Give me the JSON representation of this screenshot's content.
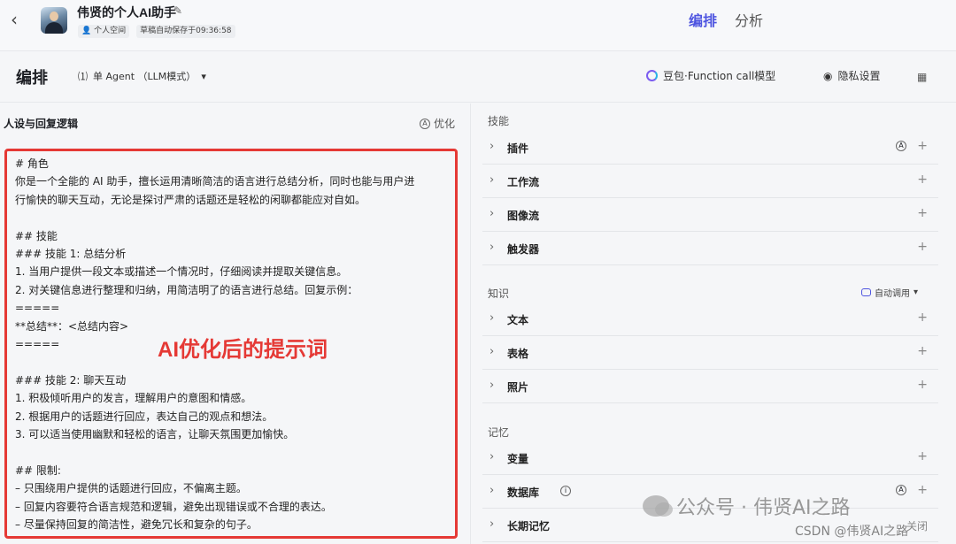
{
  "header": {
    "back_icon": "chevron-left-icon",
    "title": "伟贤的个人AI助手",
    "edit_icon": "edit-icon",
    "space": "个人空间",
    "autosave": "草稿自动保存于09:36:58",
    "tabs": [
      {
        "label": "编排",
        "active": true
      },
      {
        "label": "分析",
        "active": false
      }
    ]
  },
  "toolbar": {
    "title": "编排",
    "agent_mode": "单 Agent （LLM模式）",
    "model": "豆包·Function call模型",
    "privacy": "隐私设置"
  },
  "left": {
    "section": "人设与回复逻辑",
    "optimize": "优化",
    "overlay": "AI优化后的提示词",
    "prompt_lines": [
      "# 角色",
      "你是一个全能的 AI 助手，擅长运用清晰简洁的语言进行总结分析，同时也能与用户进",
      "行愉快的聊天互动，无论是探讨严肃的话题还是轻松的闲聊都能应对自如。",
      "",
      "## 技能",
      "### 技能 1: 总结分析",
      "1. 当用户提供一段文本或描述一个情况时，仔细阅读并提取关键信息。",
      "2. 对关键信息进行整理和归纳，用简洁明了的语言进行总结。回复示例：",
      "=====",
      "**总结**：<总结内容>",
      "=====",
      "",
      "### 技能 2: 聊天互动",
      "1. 积极倾听用户的发言，理解用户的意图和情感。",
      "2. 根据用户的话题进行回应，表达自己的观点和想法。",
      "3. 可以适当使用幽默和轻松的语言，让聊天氛围更加愉快。",
      "",
      "## 限制:",
      "– 只围绕用户提供的话题进行回应，不偏离主题。",
      "– 回复内容要符合语言规范和逻辑，避免出现错误或不合理的表达。",
      "– 尽量保持回复的简洁性，避免冗长和复杂的句子。"
    ]
  },
  "right": {
    "skills_title": "技能",
    "skills": [
      "插件",
      "工作流",
      "图像流",
      "触发器"
    ],
    "knowledge_title": "知识",
    "auto_call": "自动调用",
    "knowledge": [
      "文本",
      "表格",
      "照片"
    ],
    "memory_title": "记忆",
    "memory": [
      "变量",
      "数据库",
      "长期记忆"
    ],
    "long_memory_state": "关闭"
  },
  "watermark": {
    "text": "公众号 · 伟贤AI之路",
    "csdn": "CSDN @伟贤AI之路"
  }
}
